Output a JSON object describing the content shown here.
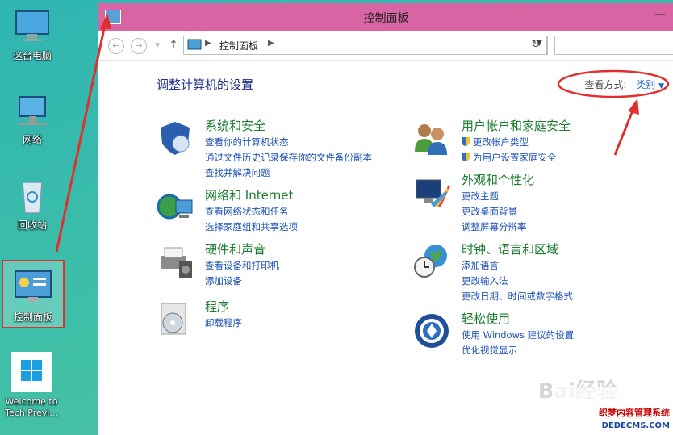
{
  "desktop": {
    "icons": [
      {
        "label": "这台电脑",
        "icon": "computer-icon"
      },
      {
        "label": "网络",
        "icon": "network-icon"
      },
      {
        "label": "回收站",
        "icon": "recycle-bin-icon"
      },
      {
        "label": "控制面板",
        "icon": "control-panel-icon"
      },
      {
        "label": "Welcome to Tech Previ...",
        "icon": "windows-logo-icon"
      }
    ]
  },
  "window": {
    "title": "控制面板",
    "address": "控制面板",
    "heading": "调整计算机的设置",
    "view_by_label": "查看方式:",
    "view_by_value": "类别"
  },
  "categories": [
    {
      "title": "系统和安全",
      "icon": "security-shield-icon",
      "links": [
        "查看你的计算机状态",
        "通过文件历史记录保存你的文件备份副本",
        "查找并解决问题"
      ]
    },
    {
      "title": "网络和 Internet",
      "icon": "network-globe-icon",
      "links": [
        "查看网络状态和任务",
        "选择家庭组和共享选项"
      ]
    },
    {
      "title": "硬件和声音",
      "icon": "printer-icon",
      "links": [
        "查看设备和打印机",
        "添加设备"
      ]
    },
    {
      "title": "程序",
      "icon": "programs-icon",
      "links": [
        "卸载程序"
      ]
    },
    {
      "title": "用户帐户和家庭安全",
      "icon": "users-icon",
      "links": [
        "更改帐户类型",
        "为用户设置家庭安全"
      ]
    },
    {
      "title": "外观和个性化",
      "icon": "appearance-icon",
      "links": [
        "更改主题",
        "更改桌面背景",
        "调整屏幕分辨率"
      ]
    },
    {
      "title": "时钟、语言和区域",
      "icon": "clock-globe-icon",
      "links": [
        "添加语言",
        "更改输入法",
        "更改日期、时间或数字格式"
      ]
    },
    {
      "title": "轻松使用",
      "icon": "ease-of-access-icon",
      "links": [
        "使用 Windows 建议的设置",
        "优化视觉显示"
      ]
    }
  ],
  "watermark": {
    "brand": "Bai经验",
    "site1": "织梦内容管理系统",
    "site2": "DEDECMS.COM"
  },
  "colors": {
    "titlebar": "#d864a4",
    "accent": "#1f53b8",
    "category_title": "#1a7d2f",
    "annotation": "#e0302d"
  }
}
